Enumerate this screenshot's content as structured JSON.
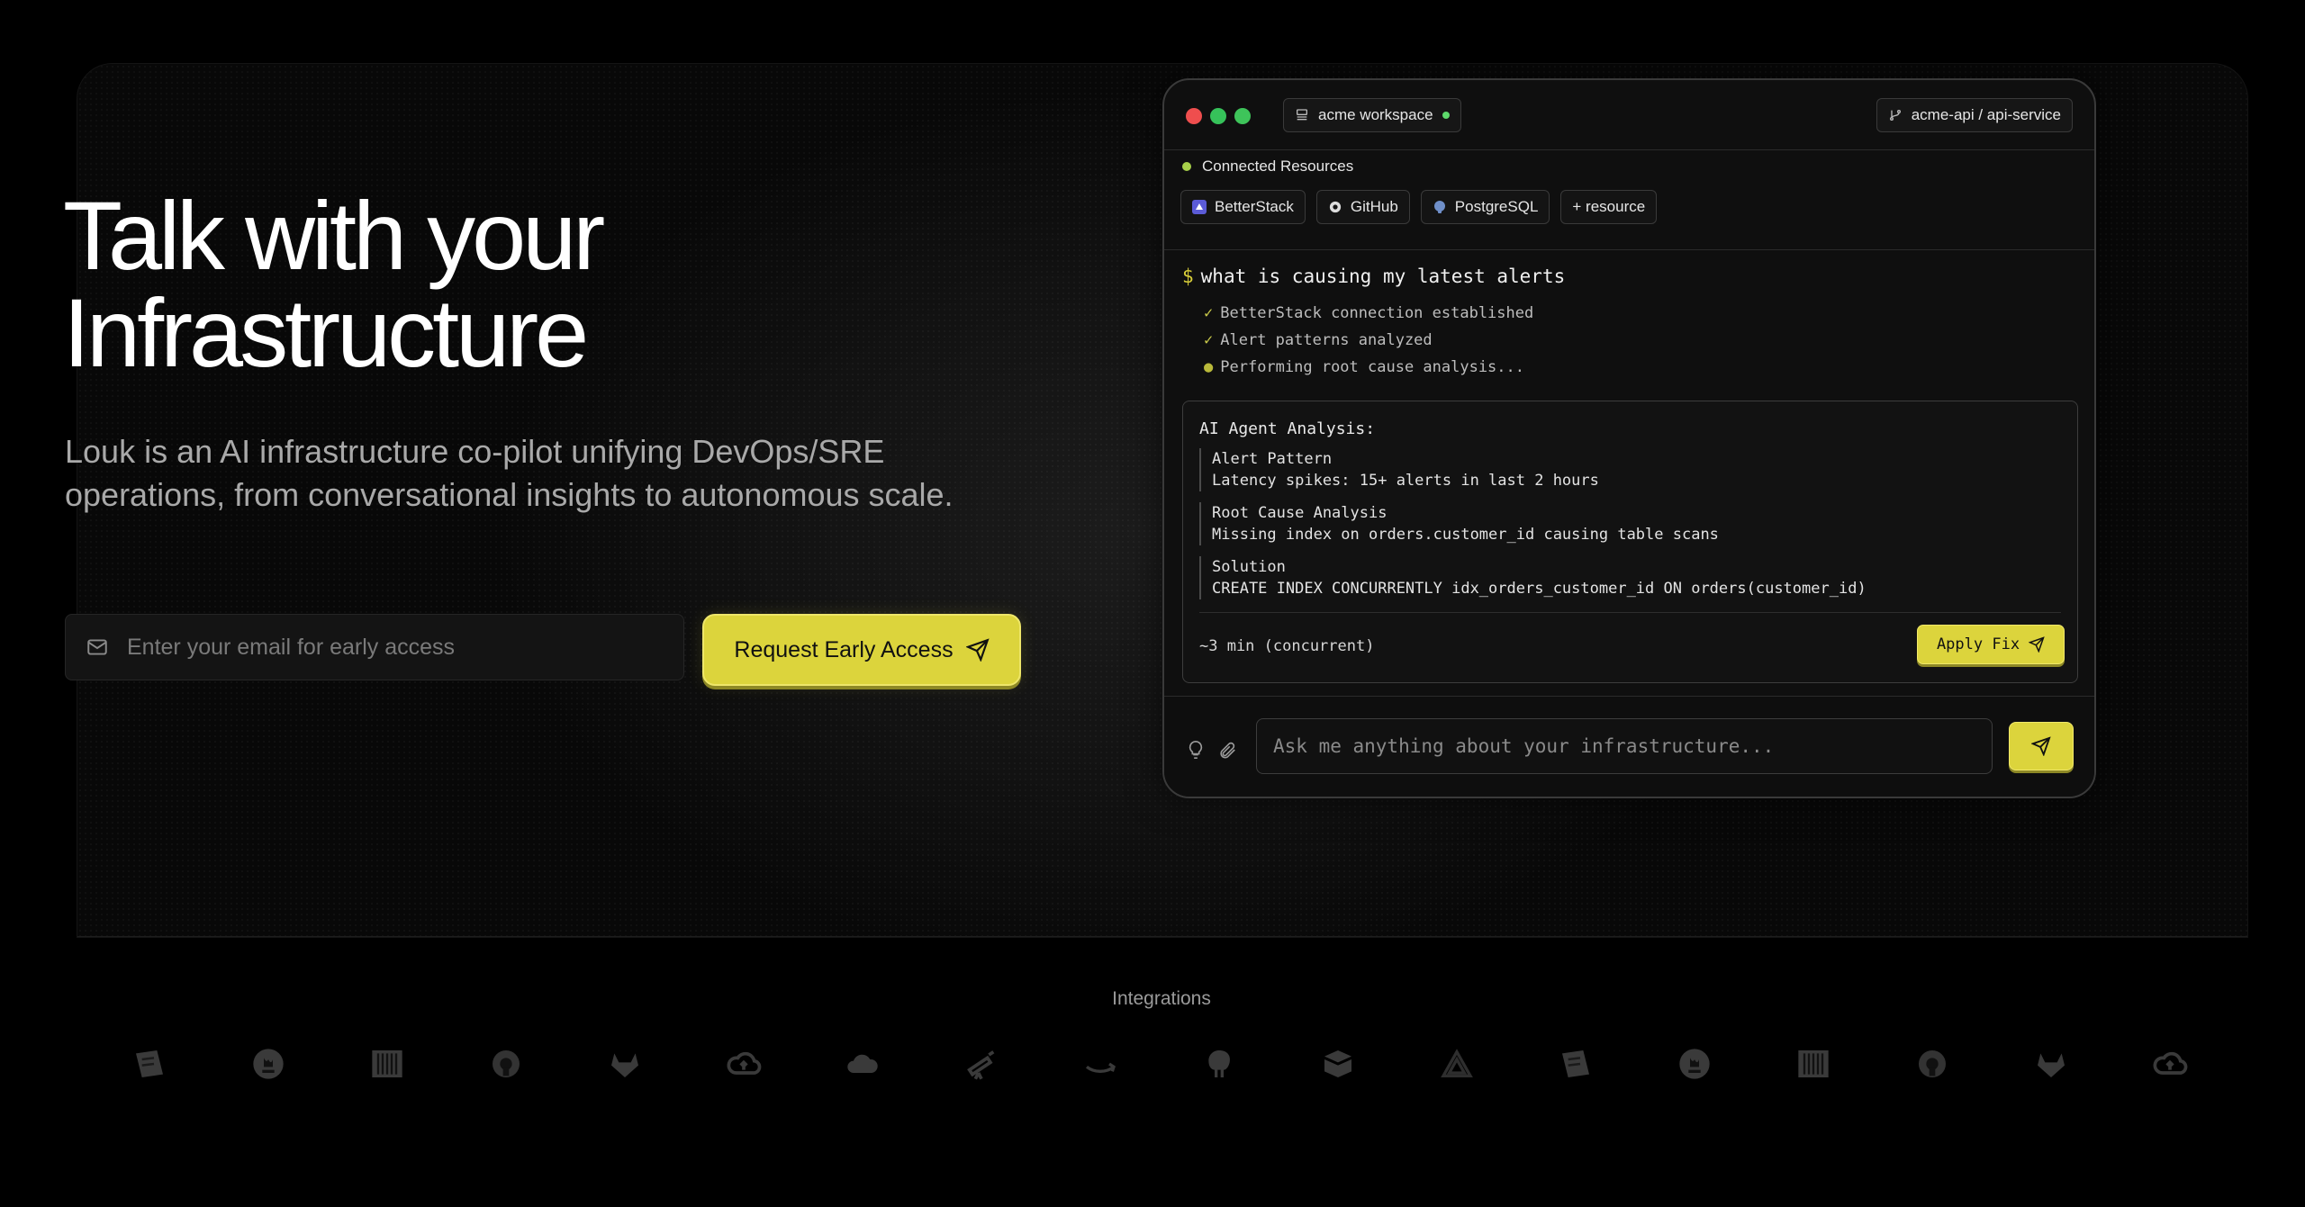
{
  "hero": {
    "title_line1": "Talk with your",
    "title_line2": "Infrastructure",
    "subtitle": "Louk is an AI infrastructure co-pilot unifying DevOps/SRE operations, from conversational insights to autonomous scale.",
    "email_placeholder": "Enter your email for early access",
    "cta_label": "Request Early Access"
  },
  "terminal": {
    "workspace": "acme workspace",
    "repo": "acme-api / api-service",
    "resources_label": "Connected Resources",
    "resources": [
      "BetterStack",
      "GitHub",
      "PostgreSQL",
      "+ resource"
    ],
    "prompt_symbol": "$",
    "prompt": "what is causing my latest alerts",
    "steps": [
      {
        "mark": "✓",
        "text": "BetterStack connection established"
      },
      {
        "mark": "✓",
        "text": "Alert patterns analyzed"
      },
      {
        "mark": "●",
        "text": "Performing root cause analysis..."
      }
    ],
    "analysis": {
      "title": "AI Agent Analysis:",
      "blocks": [
        {
          "heading": "Alert Pattern",
          "body": "Latency spikes: 15+ alerts in last 2 hours"
        },
        {
          "heading": "Root Cause Analysis",
          "body": "Missing index on orders.customer_id causing table scans"
        },
        {
          "heading": "Solution",
          "body": "CREATE INDEX CONCURRENTLY idx_orders_customer_id ON orders(customer_id)"
        }
      ],
      "duration": "~3 min (concurrent)",
      "apply_label": "Apply Fix"
    },
    "ask_placeholder": "Ask me anything about your infrastructure..."
  },
  "integrations": {
    "label": "Integrations"
  },
  "colors": {
    "accent": "#dcd43c",
    "dot_red": "#ef4e4e",
    "dot_yellow": "#2fbf4e",
    "dot_green": "#3ec45a",
    "status_green": "#5ed96b"
  }
}
